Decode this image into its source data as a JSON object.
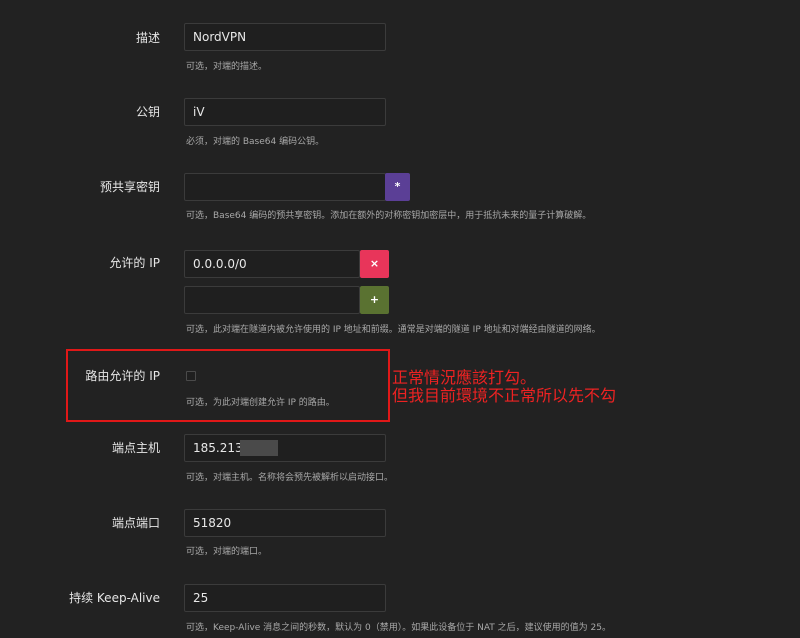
{
  "fields": {
    "description": {
      "label": "描述",
      "value": "NordVPN",
      "hint": "可选，对端的描述。"
    },
    "public_key": {
      "label": "公钥",
      "value": "iV",
      "hint": "必须，对端的 Base64 编码公钥。"
    },
    "preshared_key": {
      "label": "预共享密钥",
      "value": "",
      "button": "*",
      "hint": "可选，Base64 编码的预共享密钥。添加在额外的对称密钥加密层中，用于抵抗未来的量子计算破解。"
    },
    "allowed_ips": {
      "label": "允许的 IP",
      "values": [
        "0.0.0.0/0",
        ""
      ],
      "remove_button": "×",
      "add_button": "+",
      "hint": "可选，此对端在隧道内被允许使用的 IP 地址和前缀。通常是对端的隧道 IP 地址和对端经由隧道的网络。"
    },
    "route_allowed_ips": {
      "label": "路由允许的 IP",
      "checked": false,
      "hint": "可选，为此对端创建允许 IP 的路由。"
    },
    "endpoint_host": {
      "label": "端点主机",
      "value": "185.213.",
      "hint": "可选，对端主机。名称将会预先被解析以启动接口。"
    },
    "endpoint_port": {
      "label": "端点端口",
      "value": "51820",
      "hint": "可选，对端的端口。"
    },
    "keepalive": {
      "label": "持续 Keep-Alive",
      "value": "25",
      "hint": "可选，Keep-Alive 消息之间的秒数，默认为 0（禁用）。如果此设备位于 NAT 之后，建议使用的值为 25。"
    }
  },
  "annotation": {
    "line1": "正常情況應該打勾。",
    "line2": "但我目前環境不正常所以先不勾"
  },
  "colors": {
    "background": "#222222",
    "key_button": "#5b3f96",
    "remove_button": "#e8355a",
    "add_button": "#5a7231",
    "annotation": "#ee2222"
  }
}
